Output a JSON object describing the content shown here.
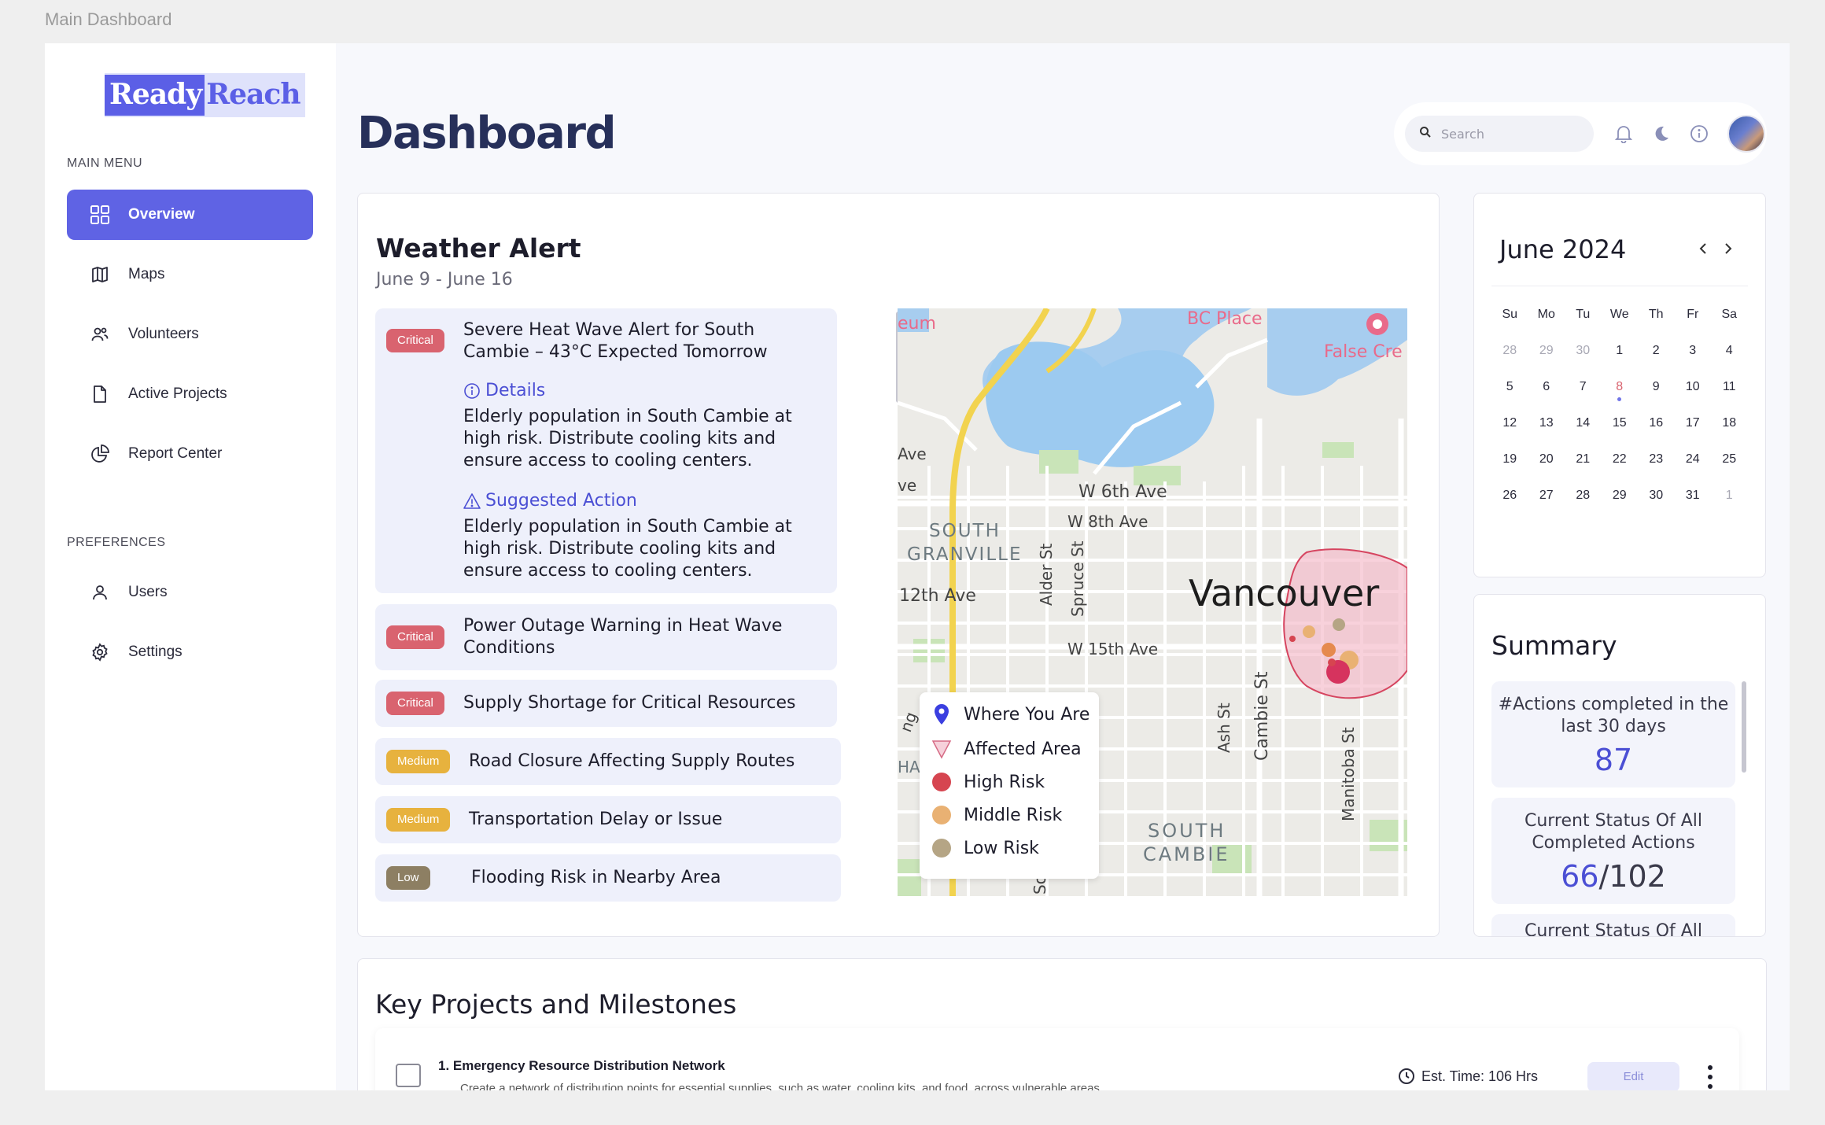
{
  "window": {
    "title": "Main Dashboard"
  },
  "brand": {
    "part1": "Ready",
    "part2": "Reach"
  },
  "sidebar": {
    "main_menu_label": "MAIN MENU",
    "preferences_label": "PREFERENCES",
    "main_items": [
      {
        "label": "Overview",
        "icon": "grid-icon",
        "active": true
      },
      {
        "label": "Maps",
        "icon": "map-icon"
      },
      {
        "label": "Volunteers",
        "icon": "people-icon"
      },
      {
        "label": "Active Projects",
        "icon": "document-icon"
      },
      {
        "label": "Report Center",
        "icon": "pie-chart-icon"
      }
    ],
    "pref_items": [
      {
        "label": "Users",
        "icon": "user-icon"
      },
      {
        "label": "Settings",
        "icon": "gear-icon"
      }
    ]
  },
  "header": {
    "title": "Dashboard",
    "search_placeholder": "Search"
  },
  "weather": {
    "title": "Weather Alert",
    "range": "June 9 - June 16",
    "alerts": [
      {
        "severity": "Critical",
        "title": "Severe Heat Wave Alert for South Cambie – 43°C Expected Tomorrow",
        "details_label": "Details",
        "details_text": "Elderly population in South Cambie at high risk. Distribute cooling kits and ensure access to cooling centers.",
        "action_label": "Suggested Action",
        "action_text": "Elderly population in South Cambie at high risk. Distribute cooling kits and ensure access to cooling centers."
      },
      {
        "severity": "Critical",
        "title": "Power Outage Warning in Heat Wave Conditions"
      },
      {
        "severity": "Critical",
        "title": "Supply Shortage for Critical Resources"
      },
      {
        "severity": "Medium",
        "title": "Road Closure Affecting Supply Routes"
      },
      {
        "severity": "Medium",
        "title": "Transportation Delay or Issue"
      },
      {
        "severity": "Low",
        "title": "Flooding Risk in Nearby Area"
      }
    ],
    "map": {
      "city": "Vancouver",
      "labels": {
        "w6": "W 6th Ave",
        "w8": "W 8th Ave",
        "w12": "12th Ave",
        "w15": "W 15th Ave",
        "south_granville_1": "SOUTH",
        "south_granville_2": "GRANVILLE",
        "south_cambie_1": "SOUTH",
        "south_cambie_2": "CAMBIE",
        "alder": "Alder St",
        "spruce": "Spruce St",
        "ash": "Ash St",
        "cambie": "Cambie St",
        "manitoba": "Manitoba St",
        "bc_place": "BC Place",
        "false_cr": "False Cre",
        "eum": "eum",
        "ave1": "Ave",
        "ave2": "ve",
        "ha": "HA",
        "ng": "ng",
        "so": "So"
      },
      "legend": [
        {
          "label": "Where You Are",
          "kind": "pin",
          "color": "#3b3fe0"
        },
        {
          "label": "Affected Area",
          "kind": "triangle",
          "color": "#e9a3b3"
        },
        {
          "label": "High Risk",
          "kind": "dot",
          "color": "#d64550"
        },
        {
          "label": "Middle Risk",
          "kind": "dot",
          "color": "#e9b173"
        },
        {
          "label": "Low Risk",
          "kind": "dot",
          "color": "#b5a585"
        }
      ]
    }
  },
  "calendar": {
    "title": "June 2024",
    "weekdays": [
      "Su",
      "Mo",
      "Tu",
      "We",
      "Th",
      "Fr",
      "Sa"
    ],
    "weeks": [
      [
        "28",
        "29",
        "30",
        "1",
        "2",
        "3",
        "4"
      ],
      [
        "5",
        "6",
        "7",
        "8",
        "9",
        "10",
        "11"
      ],
      [
        "12",
        "13",
        "14",
        "15",
        "16",
        "17",
        "18"
      ],
      [
        "19",
        "20",
        "21",
        "22",
        "23",
        "24",
        "25"
      ],
      [
        "26",
        "27",
        "28",
        "29",
        "30",
        "31",
        "1"
      ]
    ],
    "today": "8"
  },
  "summary": {
    "title": "Summary",
    "stats": [
      {
        "label": "#Actions completed in the last 30 days",
        "value": "87"
      },
      {
        "label": "Current Status Of All Completed Actions",
        "value": "66",
        "total": "/102"
      },
      {
        "label": "Current Status Of All"
      }
    ]
  },
  "projects": {
    "title": "Key Projects and Milestones",
    "items": [
      {
        "name": "1. Emergency Resource Distribution Network",
        "description": "Create a network of distribution points for essential supplies, such as water, cooling kits, and food, across vulnerable areas",
        "time": "Est. Time: 106 Hrs",
        "edit_label": "Edit"
      }
    ]
  },
  "colors": {
    "accent": "#5f63e4",
    "critical": "#d9636f",
    "medium": "#e7b23e",
    "low": "#8d7f63"
  }
}
